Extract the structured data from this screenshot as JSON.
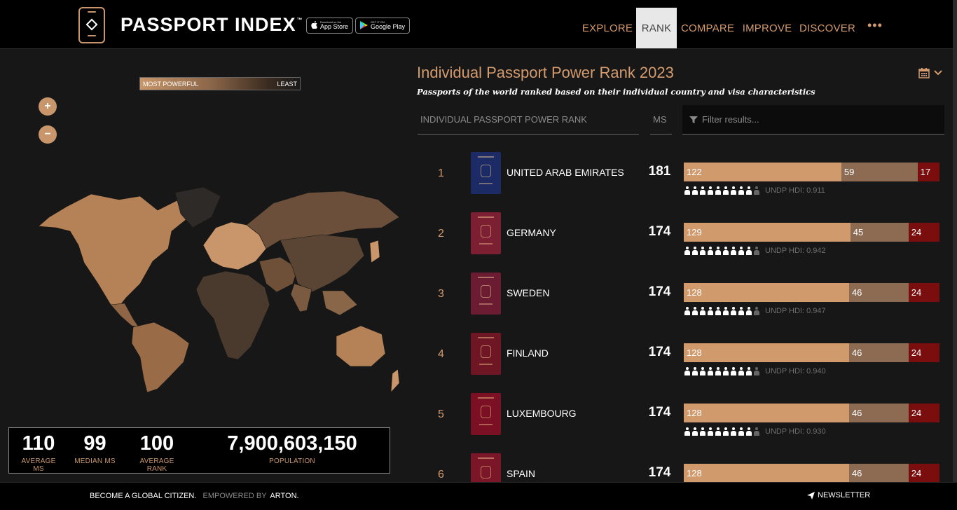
{
  "header": {
    "brand": "PASSPORT INDEX",
    "trademark": "™",
    "app_store": {
      "small": "Download on the",
      "big": "App Store"
    },
    "google_play": {
      "small": "GET IT ON",
      "big": "Google Play"
    },
    "nav": [
      {
        "label": "EXPLORE",
        "active": false
      },
      {
        "label": "RANK",
        "active": true
      },
      {
        "label": "COMPARE",
        "active": false
      },
      {
        "label": "IMPROVE",
        "active": false
      },
      {
        "label": "DISCOVER",
        "active": false
      }
    ],
    "more": "•••"
  },
  "map_panel": {
    "legend_most": "MOST POWERFUL",
    "legend_least": "LEAST",
    "zoom_in": "+",
    "zoom_out": "−",
    "stats": [
      {
        "value": "110",
        "label": "AVERAGE MS"
      },
      {
        "value": "99",
        "label": "MEDIAN MS"
      },
      {
        "value": "100",
        "label": "AVERAGE RANK"
      },
      {
        "value": "7,900,603,150",
        "label": "POPULATION"
      }
    ]
  },
  "main": {
    "title": "Individual Passport Power Rank 2023",
    "subtitle": "Passports of the world ranked based on their individual country and visa characteristics",
    "col_rank": "INDIVIDUAL PASSPORT POWER RANK",
    "col_ms": "MS",
    "filter_placeholder": "Filter results...",
    "rows": [
      {
        "rank": "1",
        "country": "UNITED ARAB EMIRATES",
        "ms": "181",
        "visa_free": 122,
        "visa_on_arrival": 59,
        "visa_required": 17,
        "hdi": "UNDP HDI: 0.911",
        "hdi_level": 9,
        "passport_color": "#1c2a66"
      },
      {
        "rank": "2",
        "country": "GERMANY",
        "ms": "174",
        "visa_free": 129,
        "visa_on_arrival": 45,
        "visa_required": 24,
        "hdi": "UNDP HDI: 0.942",
        "hdi_level": 9,
        "passport_color": "#7d1f33"
      },
      {
        "rank": "3",
        "country": "SWEDEN",
        "ms": "174",
        "visa_free": 128,
        "visa_on_arrival": 46,
        "visa_required": 24,
        "hdi": "UNDP HDI: 0.947",
        "hdi_level": 9,
        "passport_color": "#6b1c33"
      },
      {
        "rank": "4",
        "country": "FINLAND",
        "ms": "174",
        "visa_free": 128,
        "visa_on_arrival": 46,
        "visa_required": 24,
        "hdi": "UNDP HDI: 0.940",
        "hdi_level": 9,
        "passport_color": "#6e1624"
      },
      {
        "rank": "5",
        "country": "LUXEMBOURG",
        "ms": "174",
        "visa_free": 128,
        "visa_on_arrival": 46,
        "visa_required": 24,
        "hdi": "UNDP HDI: 0.930",
        "hdi_level": 9,
        "passport_color": "#7b0f24"
      },
      {
        "rank": "6",
        "country": "SPAIN",
        "ms": "174",
        "visa_free": 128,
        "visa_on_arrival": 46,
        "visa_required": 24,
        "hdi": "",
        "hdi_level": 0,
        "passport_color": "#7a1628"
      }
    ],
    "bar_total": 198
  },
  "footer": {
    "tagline": "BECOME A GLOBAL CITIZEN.",
    "empowered": "EMPOWERED BY",
    "arton": "ARTON.",
    "newsletter": "NEWSLETTER"
  },
  "colors": {
    "accent": "#d49b6e",
    "visa_free": "#d09a6c",
    "visa_on_arrival": "#8d6b53",
    "visa_required": "#7a0e0e"
  }
}
